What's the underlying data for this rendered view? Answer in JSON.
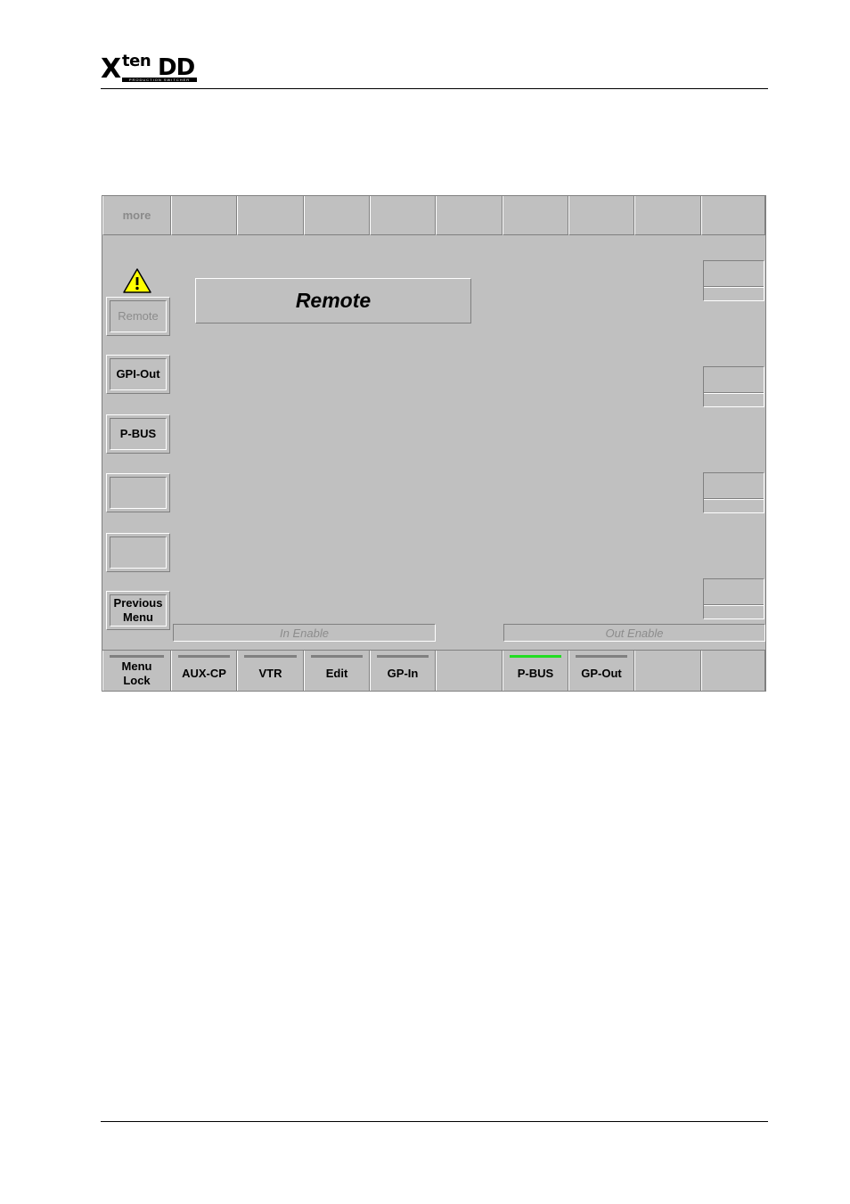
{
  "document": {
    "logo": {
      "main": "X",
      "sup": "ten",
      "brand": "DD",
      "tagline": "PRODUCTION SWITCHER"
    }
  },
  "panel": {
    "top_buttons": [
      "more",
      "",
      "",
      "",
      "",
      "",
      "",
      "",
      "",
      ""
    ],
    "left_buttons": [
      {
        "label": "Remote",
        "disabled": true
      },
      {
        "label": "GPI-Out"
      },
      {
        "label": "P-BUS"
      },
      {
        "label": ""
      },
      {
        "label": ""
      },
      {
        "label": "Previous\nMenu"
      }
    ],
    "title": "Remote",
    "enable_in": "In Enable",
    "enable_out": "Out Enable",
    "bottom_buttons": [
      {
        "label": "Menu\nLock",
        "lamp": "off"
      },
      {
        "label": "AUX-CP",
        "lamp": "off"
      },
      {
        "label": "VTR",
        "lamp": "off"
      },
      {
        "label": "Edit",
        "lamp": "off"
      },
      {
        "label": "GP-In",
        "lamp": "off"
      },
      {
        "label": "",
        "lamp": "none"
      },
      {
        "label": "P-BUS",
        "lamp": "on"
      },
      {
        "label": "GP-Out",
        "lamp": "off"
      },
      {
        "label": "",
        "lamp": "none"
      },
      {
        "label": "",
        "lamp": "none"
      }
    ],
    "colors": {
      "panel": "#c0c0c0",
      "lamp_on": "#22dd22",
      "lamp_off": "#808080",
      "warning": "#ffff00"
    }
  }
}
